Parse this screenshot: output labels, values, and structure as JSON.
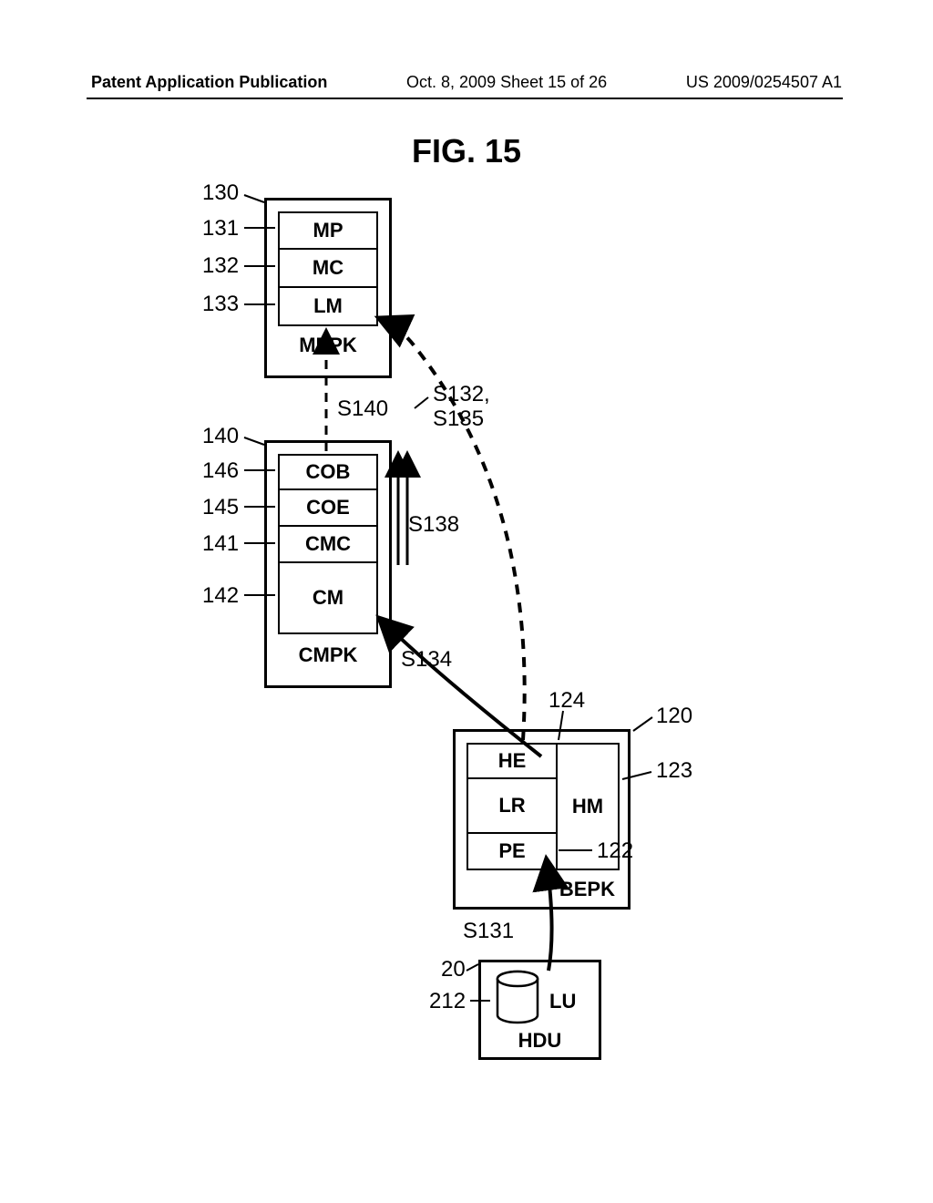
{
  "header": {
    "left": "Patent Application Publication",
    "center": "Oct. 8, 2009  Sheet 15 of 26",
    "right": "US 2009/0254507 A1"
  },
  "figure_title": "FIG. 15",
  "mppk": {
    "ref": "130",
    "title": "MPPK",
    "rows": [
      {
        "ref": "131",
        "label": "MP"
      },
      {
        "ref": "132",
        "label": "MC"
      },
      {
        "ref": "133",
        "label": "LM"
      }
    ]
  },
  "cmpk": {
    "ref": "140",
    "title": "CMPK",
    "rows": [
      {
        "ref": "146",
        "label": "COB"
      },
      {
        "ref": "145",
        "label": "COE"
      },
      {
        "ref": "141",
        "label": "CMC"
      },
      {
        "ref": "142",
        "label": "CM"
      }
    ]
  },
  "bepk": {
    "ref": "120",
    "title": "BEPK",
    "he_ref": "124",
    "pe_ref": "122",
    "hm_ref": "123",
    "he": "HE",
    "lr": "LR",
    "pe": "PE",
    "hm": "HM"
  },
  "hdu": {
    "ref": "20",
    "lu_ref": "212",
    "title": "HDU",
    "lu": "LU"
  },
  "signals": {
    "s131": "S131",
    "s132_s135_a": "S132,",
    "s132_s135_b": "S135",
    "s134": "S134",
    "s138": "S138",
    "s140": "S140"
  }
}
